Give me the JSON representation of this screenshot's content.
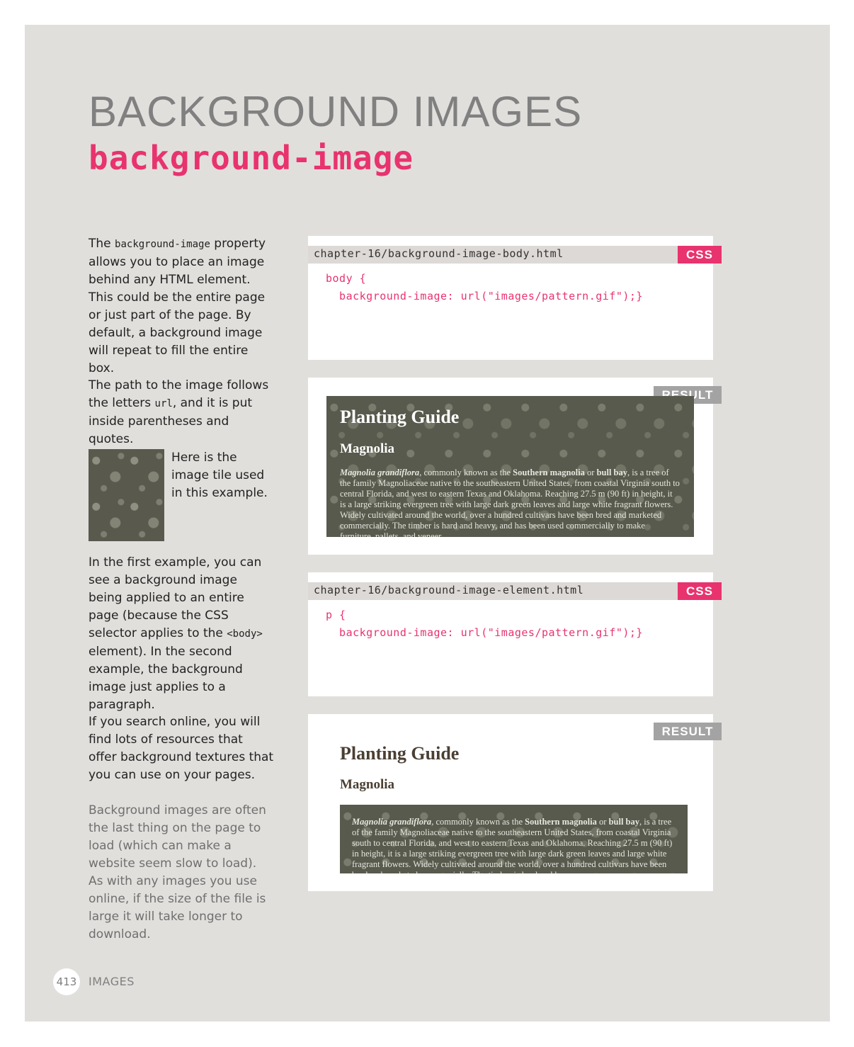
{
  "header": {
    "title": "BACKGROUND IMAGES",
    "subtitle": "background-image"
  },
  "sidebar": {
    "p1_before": "The ",
    "p1_code": "background-image",
    "p1_after": " property allows you to place an image behind any HTML element. This could be the entire page or just part of the page. By default, a background image will repeat to fill the entire box.",
    "p2_before": "The path to the image follows the letters ",
    "p2_code": "url",
    "p2_after": ", and it is put inside parentheses and quotes.",
    "tile_caption": "Here is the image tile used in this example.",
    "p3_before": "In the first example, you can see a background image being applied to an entire page (because the CSS selector applies to the ",
    "p3_code": "<body>",
    "p3_after": " element). In the second example, the background image just applies to a paragraph.",
    "p4": "If you search online, you will find lots of resources that offer background textures that you can use on your pages.",
    "p5": "Background images are often the last thing on the page to load (which can make a website seem slow to load). As with any images you use online, if the size of the file is large it will take longer to download."
  },
  "example1": {
    "file": "chapter-16/background-image-body.html",
    "tag": "CSS",
    "code_line1": "body {",
    "code_line2": "  background-image: url(\"images/pattern.gif\");}"
  },
  "result1": {
    "tag": "RESULT",
    "h1": "Planting Guide",
    "h2": "Magnolia",
    "p_italic": "Magnolia grandiflora",
    "p_part1": ", commonly known as the ",
    "p_bold1": "Southern magnolia",
    "p_part2": " or ",
    "p_bold2": "bull bay",
    "p_part3": ", is a tree of the family Magnoliaceae native to the southeastern United States, from coastal Virginia south to central Florida, and west to eastern Texas and Oklahoma. Reaching 27.5 m (90 ft) in height, it is a large striking evergreen tree with large dark green leaves and large white fragrant flowers. Widely cultivated around the world, over a hundred cultivars have been bred and marketed commercially. The timber is hard and heavy, and has been used commercially to make furniture, pallets, and veneer."
  },
  "example2": {
    "file": "chapter-16/background-image-element.html",
    "tag": "CSS",
    "code_line1": "p {",
    "code_line2": "  background-image: url(\"images/pattern.gif\");}"
  },
  "result2": {
    "tag": "RESULT",
    "h1": "Planting Guide",
    "h2": "Magnolia",
    "p_italic": "Magnolia grandiflora",
    "p_part1": ", commonly known as the ",
    "p_bold1": "Southern magnolia",
    "p_part2": " or ",
    "p_bold2": "bull bay",
    "p_part3": ", is a tree of the family Magnoliaceae native to the southeastern United States, from coastal Virginia south to central Florida, and west to eastern Texas and Oklahoma. Reaching 27.5 m (90 ft) in height, it is a large striking evergreen tree with large dark green leaves and large white fragrant flowers. Widely cultivated around the world, over a hundred cultivars have been bred and marketed commercially. The timber is hard and heavy."
  },
  "footer": {
    "page_number": "413",
    "section": "IMAGES"
  },
  "colors": {
    "accent": "#e8336f",
    "page_background": "#e1dfdc",
    "result_tag": "#a3a3a3",
    "texture": "#575a4c"
  }
}
